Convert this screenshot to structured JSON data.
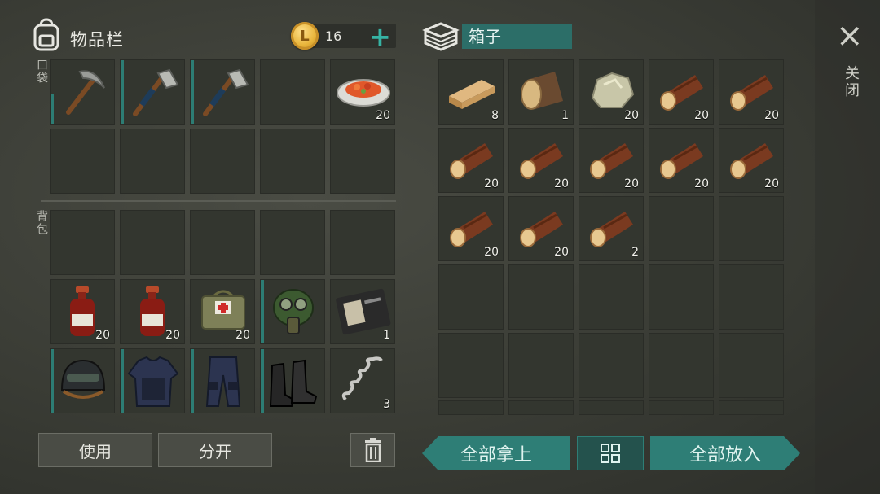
{
  "header": {
    "inventory_title": "物品栏",
    "coin_amount": "16",
    "coin_symbol": "L",
    "plus_label": "+",
    "container_name": "箱子"
  },
  "sections": {
    "pocket_label": "口袋",
    "backpack_label": "背包"
  },
  "close": {
    "icon": "×",
    "label": "关闭"
  },
  "pocket_slots": [
    {
      "item": "pickaxe-icon",
      "qty": ""
    },
    {
      "item": "hatchet-icon",
      "qty": ""
    },
    {
      "item": "hatchet-icon",
      "qty": ""
    },
    {
      "item": "",
      "qty": ""
    },
    {
      "item": "food-plate-icon",
      "qty": "20"
    },
    {
      "item": "",
      "qty": ""
    },
    {
      "item": "",
      "qty": ""
    },
    {
      "item": "",
      "qty": ""
    },
    {
      "item": "",
      "qty": ""
    },
    {
      "item": "",
      "qty": ""
    }
  ],
  "backpack_slots": [
    {
      "item": "",
      "qty": ""
    },
    {
      "item": "",
      "qty": ""
    },
    {
      "item": "",
      "qty": ""
    },
    {
      "item": "",
      "qty": ""
    },
    {
      "item": "",
      "qty": ""
    },
    {
      "item": "medicine-bottle-icon",
      "qty": "20"
    },
    {
      "item": "medicine-bottle-icon",
      "qty": "20"
    },
    {
      "item": "first-aid-bag-icon",
      "qty": "20"
    },
    {
      "item": "gas-mask-icon",
      "qty": ""
    },
    {
      "item": "wallet-icon",
      "qty": "1"
    },
    {
      "item": "helmet-icon",
      "qty": ""
    },
    {
      "item": "body-armor-icon",
      "qty": ""
    },
    {
      "item": "armored-pants-icon",
      "qty": ""
    },
    {
      "item": "boots-icon",
      "qty": ""
    },
    {
      "item": "spring-icon",
      "qty": "3"
    }
  ],
  "box_slots": [
    {
      "item": "wood-plank-icon",
      "qty": "8"
    },
    {
      "item": "log-stump-icon",
      "qty": "1"
    },
    {
      "item": "stone-icon",
      "qty": "20"
    },
    {
      "item": "log-icon",
      "qty": "20"
    },
    {
      "item": "log-icon",
      "qty": "20"
    },
    {
      "item": "log-icon",
      "qty": "20"
    },
    {
      "item": "log-icon",
      "qty": "20"
    },
    {
      "item": "log-icon",
      "qty": "20"
    },
    {
      "item": "log-icon",
      "qty": "20"
    },
    {
      "item": "log-icon",
      "qty": "20"
    },
    {
      "item": "log-icon",
      "qty": "20"
    },
    {
      "item": "log-icon",
      "qty": "20"
    },
    {
      "item": "log-icon",
      "qty": "2"
    },
    {
      "item": "",
      "qty": ""
    },
    {
      "item": "",
      "qty": ""
    }
  ],
  "buttons": {
    "use": "使用",
    "split": "分开",
    "take_all": "全部拿上",
    "sort_icon": "grid-icon",
    "put_all": "全部放入"
  },
  "colors": {
    "accent_teal": "#2e7e76",
    "slot_bg": "#33362f",
    "coin_gold": "#e8b43a"
  }
}
